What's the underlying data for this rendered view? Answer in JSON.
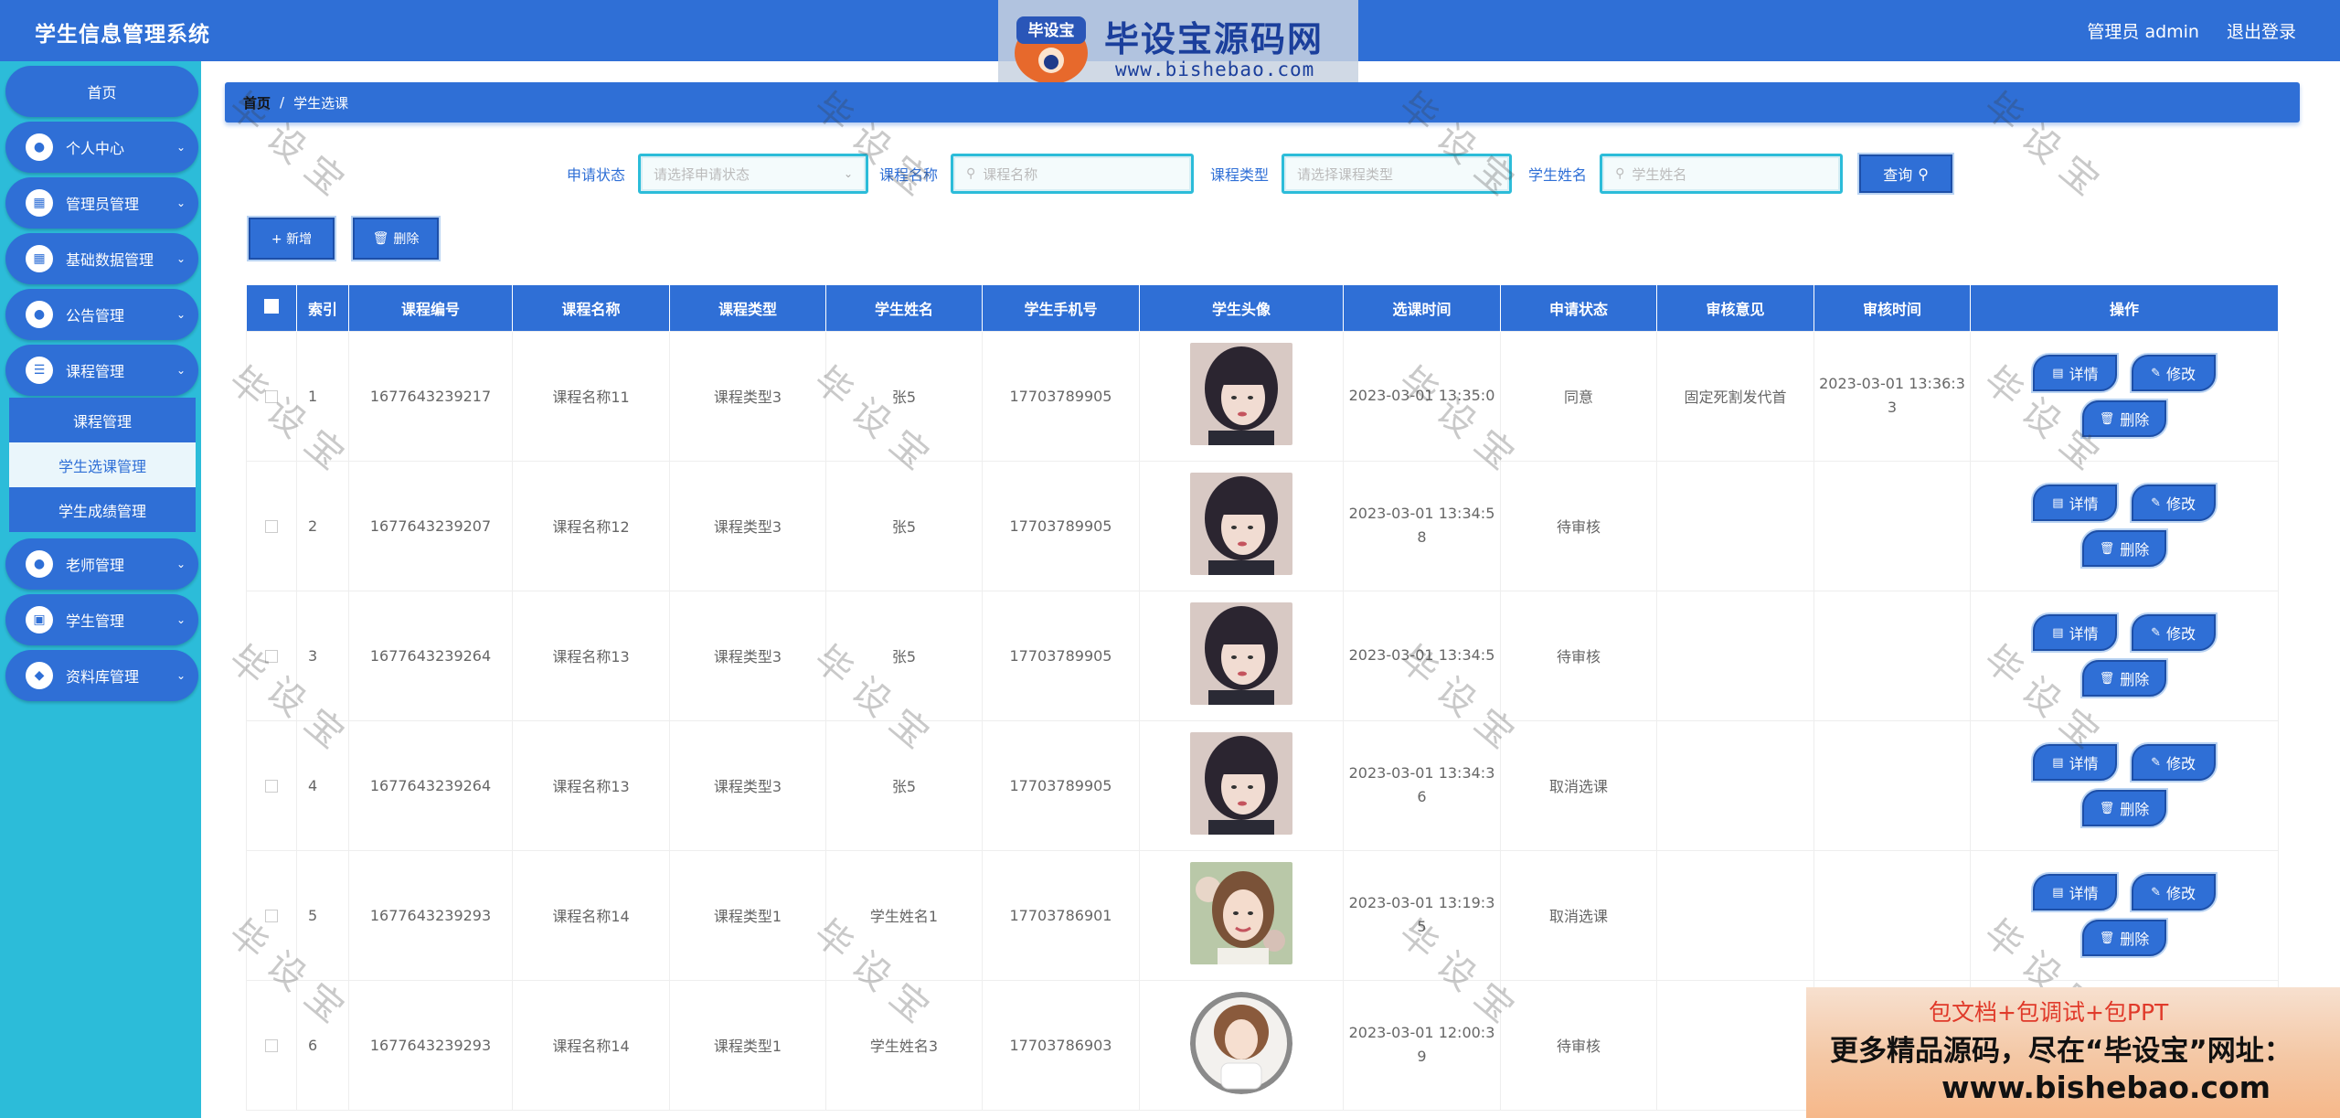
{
  "header": {
    "app_title": "学生信息管理系统",
    "admin_label": "管理员 admin",
    "logout_label": "退出登录"
  },
  "watermark": {
    "banner_title": "毕设宝源码网",
    "banner_url": "www.bishebao.com",
    "logo_text": "毕设宝",
    "diag_text": "毕设宝",
    "ad_line1": "包文档+包调试+包PPT",
    "ad_line2": "更多精品源码，尽在“毕设宝”网址：",
    "ad_line3": "www.bishebao.com"
  },
  "sidebar": {
    "home_label": "首页",
    "items": [
      {
        "label": "个人中心",
        "icon": "user-icon"
      },
      {
        "label": "管理员管理",
        "icon": "clipboard-icon"
      },
      {
        "label": "基础数据管理",
        "icon": "grid-icon"
      },
      {
        "label": "公告管理",
        "icon": "user-icon"
      },
      {
        "label": "课程管理",
        "icon": "list-icon"
      },
      {
        "label": "老师管理",
        "icon": "user-icon"
      },
      {
        "label": "学生管理",
        "icon": "briefcase-icon"
      },
      {
        "label": "资料库管理",
        "icon": "pin-icon"
      }
    ],
    "sub_items": [
      {
        "label": "课程管理"
      },
      {
        "label": "学生选课管理"
      },
      {
        "label": "学生成绩管理"
      }
    ]
  },
  "breadcrumb": {
    "home": "首页",
    "separator": "/",
    "current": "学生选课"
  },
  "filters": {
    "status_label": "申请状态",
    "status_placeholder": "请选择申请状态",
    "course_name_label": "课程名称",
    "course_name_placeholder": "课程名称",
    "course_type_label": "课程类型",
    "course_type_placeholder": "请选择课程类型",
    "student_name_label": "学生姓名",
    "student_name_placeholder": "学生姓名",
    "query_label": "查询"
  },
  "actions": {
    "add_label": "+ 新增",
    "delete_label": "删除"
  },
  "table": {
    "headers": [
      "索引",
      "课程编号",
      "课程名称",
      "课程类型",
      "学生姓名",
      "学生手机号",
      "学生头像",
      "选课时间",
      "申请状态",
      "审核意见",
      "审核时间",
      "操作"
    ],
    "rows": [
      {
        "index": "1",
        "code": "1677643239217",
        "name": "课程名称11",
        "type": "课程类型3",
        "student": "张5",
        "phone": "17703789905",
        "avatar": "photo-girl-dark",
        "time": "2023-03-01 13:35:0",
        "status": "同意",
        "opinion": "固定死割发代首",
        "audit_time": "2023-03-01 13:36:3\n3"
      },
      {
        "index": "2",
        "code": "1677643239207",
        "name": "课程名称12",
        "type": "课程类型3",
        "student": "张5",
        "phone": "17703789905",
        "avatar": "photo-girl-dark",
        "time": "2023-03-01 13:34:5\n8",
        "status": "待审核",
        "opinion": "",
        "audit_time": ""
      },
      {
        "index": "3",
        "code": "1677643239264",
        "name": "课程名称13",
        "type": "课程类型3",
        "student": "张5",
        "phone": "17703789905",
        "avatar": "photo-girl-dark",
        "time": "2023-03-01 13:34:5",
        "status": "待审核",
        "opinion": "",
        "audit_time": ""
      },
      {
        "index": "4",
        "code": "1677643239264",
        "name": "课程名称13",
        "type": "课程类型3",
        "student": "张5",
        "phone": "17703789905",
        "avatar": "photo-girl-dark",
        "time": "2023-03-01 13:34:3\n6",
        "status": "取消选课",
        "opinion": "",
        "audit_time": ""
      },
      {
        "index": "5",
        "code": "1677643239293",
        "name": "课程名称14",
        "type": "课程类型1",
        "student": "学生姓名1",
        "phone": "17703786901",
        "avatar": "photo-girl-light",
        "time": "2023-03-01 13:19:3\n5",
        "status": "取消选课",
        "opinion": "",
        "audit_time": ""
      },
      {
        "index": "6",
        "code": "1677643239293",
        "name": "课程名称14",
        "type": "课程类型1",
        "student": "学生姓名3",
        "phone": "17703786903",
        "avatar": "illustration-round",
        "time": "2023-03-01 12:00:3\n9",
        "status": "待审核",
        "opinion": "",
        "audit_time": ""
      }
    ],
    "op_detail": "详情",
    "op_edit": "修改",
    "op_delete": "删除"
  },
  "colors": {
    "primary": "#2f6fd6",
    "sidebar_bg": "#2cbcd9"
  }
}
